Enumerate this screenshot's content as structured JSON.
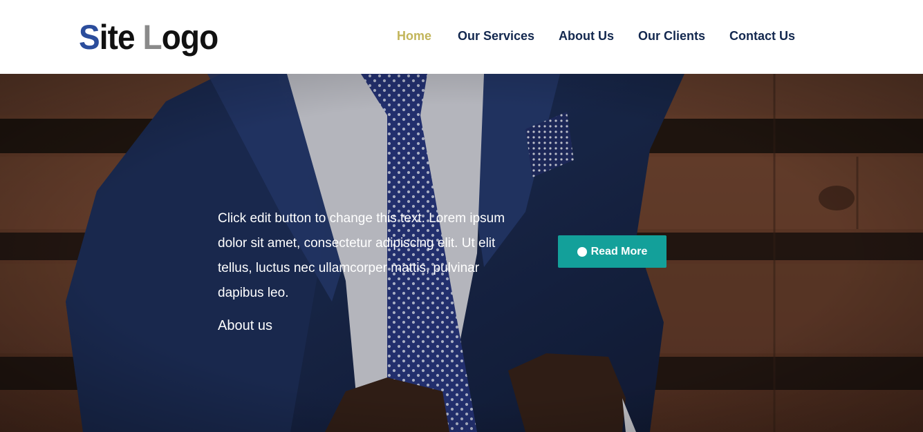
{
  "header": {
    "logo_first": "S",
    "logo_mid": "ite ",
    "logo_l": "L",
    "logo_rest": "ogo"
  },
  "nav": {
    "items": [
      {
        "label": "Home",
        "active": true
      },
      {
        "label": "Our Services"
      },
      {
        "label": "About Us"
      },
      {
        "label": "Our Clients"
      },
      {
        "label": "Contact Us"
      }
    ]
  },
  "hero": {
    "text": "Click edit button to change this text. Lorem ipsum dolor sit amet, consectetur adipiscing elit. Ut elit tellus, luctus nec ullamcorper mattis, pulvinar dapibus leo.",
    "about_link": "About us",
    "button_label": "Read More",
    "button_icon": "chevron-down-circle-icon"
  },
  "colors": {
    "accent": "#13a09a",
    "nav_active": "#c2b55a",
    "nav_text": "#13284f",
    "logo_s": "#2b4d9c",
    "logo_l": "#8a8a8a"
  }
}
